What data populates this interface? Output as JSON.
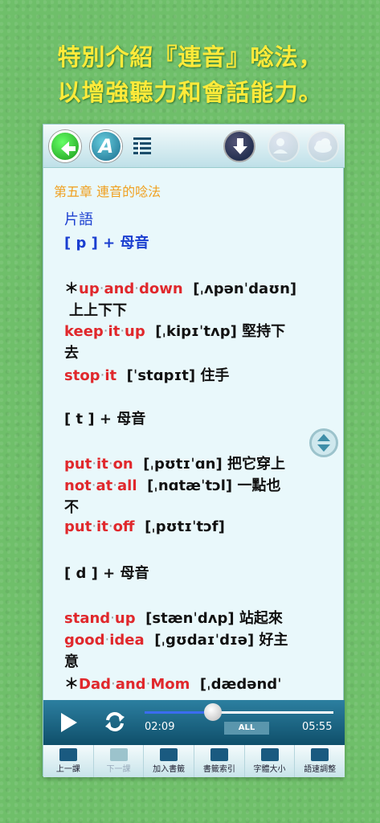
{
  "headline": {
    "line1": "特別介紹『連音』唸法，",
    "line2": "以增強聽力和會話能力。"
  },
  "topbar": {
    "back_icon": "back-arrow-icon",
    "font_label": "A",
    "list_icon": "list-icon",
    "download_icon": "download-icon",
    "people_icon": "people-icon",
    "cloud_icon": "cloud-icon"
  },
  "content": {
    "chapter": "第五章 連音的唸法",
    "section_title": "片語",
    "p_heading": "[ p ] + 母音",
    "p1_mark": "＊",
    "p1_w1": "up",
    "p1_w2": "and",
    "p1_w3": "down",
    "p1_ipa": "[ˌʌpənˈdaʊn]",
    "p1_cn": "上上下下",
    "p2_w1": "keep",
    "p2_w2": "it",
    "p2_w3": "up",
    "p2_ipa": "[ˌkipɪˈtʌp]",
    "p2_cn_a": "堅持下",
    "p2_cn_b": "去",
    "p3_w1": "stop",
    "p3_w2": "it",
    "p3_ipa": "[ˈstɑpɪt]",
    "p3_cn": "住手",
    "t_heading": "[ t ] + 母音",
    "t1_w1": "put",
    "t1_w2": "it",
    "t1_w3": "on",
    "t1_ipa": "[ˌpʊtɪˈɑn]",
    "t1_cn": "把它穿上",
    "t2_w1": "not",
    "t2_w2": "at",
    "t2_w3": "all",
    "t2_ipa": "[ˌnɑtæˈtɔl]",
    "t2_cn_a": "一點也",
    "t2_cn_b": "不",
    "t3_w1": "put",
    "t3_w2": "it",
    "t3_w3": "off",
    "t3_ipa": "[ˌpʊtɪˈtɔf]",
    "d_heading": "[ d ] + 母音",
    "d1_w1": "stand",
    "d1_w2": "up",
    "d1_ipa": "[stænˈdʌp]",
    "d1_cn": "站起來",
    "d2_w1": "good",
    "d2_w2": "idea",
    "d2_ipa": "[ˌgʊdaɪˈdɪə]",
    "d2_cn_a": "好主",
    "d2_cn_b": "意",
    "d3_mark": "＊",
    "d3_w1": "Dad",
    "d3_w2": "and",
    "d3_w3": "Mom",
    "d3_ipa": "[ˌdædəndˈ",
    "dot": "‧"
  },
  "player": {
    "current_time": "02:09",
    "total_time": "05:55",
    "mode": "ALL",
    "progress": 0.36
  },
  "bottombar": {
    "items": [
      {
        "label": "上一課"
      },
      {
        "label": "下一課"
      },
      {
        "label": "加入書籤"
      },
      {
        "label": "書籤索引"
      },
      {
        "label": "字體大小"
      },
      {
        "label": "語速調整"
      }
    ]
  },
  "colors": {
    "background": "#6fbf6a",
    "headline": "#ffea3a",
    "chapter": "#f0a020",
    "blue": "#1a3ed0",
    "red": "#e0282c",
    "player": "#1f6886"
  }
}
